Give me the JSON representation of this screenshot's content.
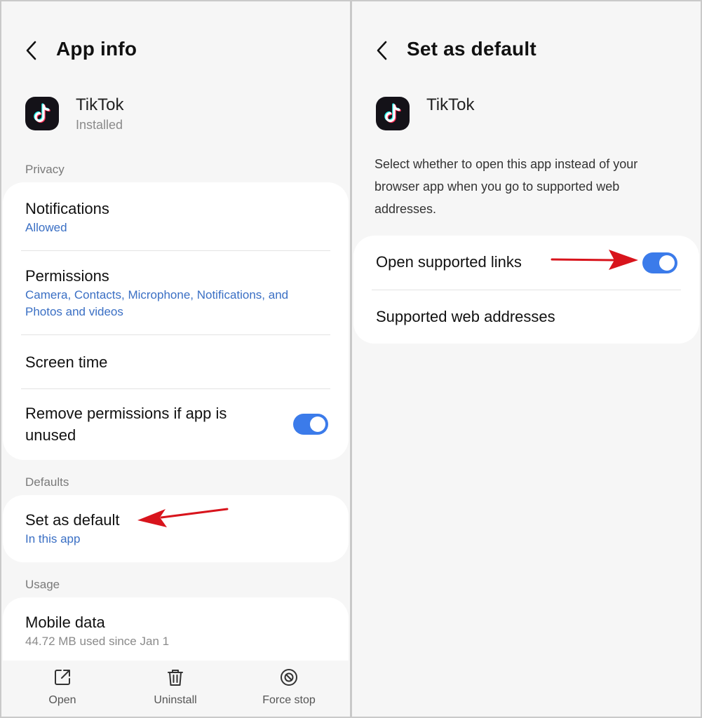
{
  "left": {
    "title": "App info",
    "app": {
      "name": "TikTok",
      "status": "Installed"
    },
    "privacy_label": "Privacy",
    "privacy_items": [
      {
        "title": "Notifications",
        "sub": "Allowed"
      },
      {
        "title": "Permissions",
        "sub": "Camera, Contacts, Microphone, Notifications, and Photos and videos"
      },
      {
        "title": "Screen time"
      },
      {
        "title": "Remove permissions if app is unused",
        "toggle_on": true
      }
    ],
    "defaults_label": "Defaults",
    "set_default": {
      "title": "Set as default",
      "sub": "In this app"
    },
    "usage_label": "Usage",
    "mobile_data": {
      "title": "Mobile data",
      "sub": "44.72 MB used since Jan 1"
    },
    "bottom": {
      "open": "Open",
      "uninstall": "Uninstall",
      "force_stop": "Force stop"
    }
  },
  "right": {
    "title": "Set as default",
    "app": {
      "name": "TikTok"
    },
    "description": "Select whether to open this app instead of your browser app when you go to supported web addresses.",
    "items": [
      {
        "title": "Open supported links",
        "toggle_on": true
      },
      {
        "title": "Supported web addresses"
      }
    ]
  },
  "colors": {
    "accent": "#3b7bea",
    "link": "#3a6fc4",
    "arrow": "#d8141c",
    "icon_bg": "#141218"
  }
}
